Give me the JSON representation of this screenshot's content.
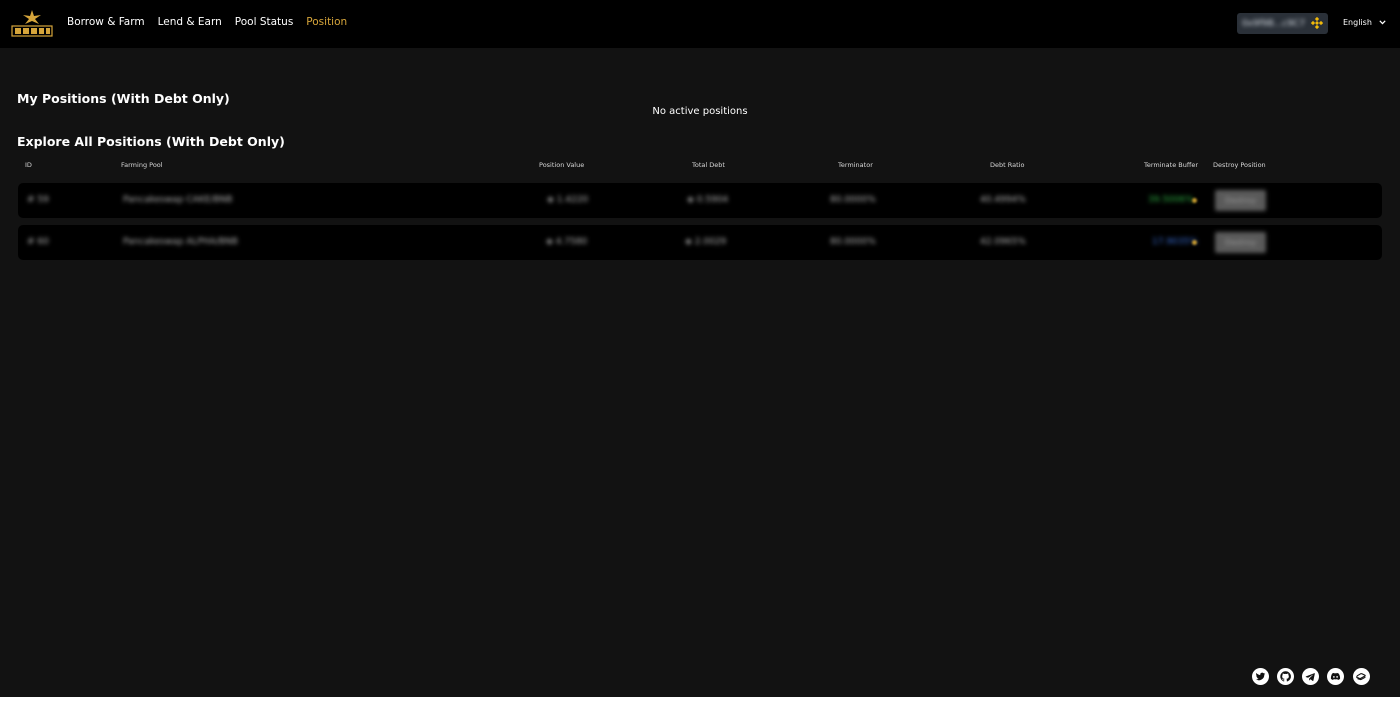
{
  "nav": {
    "items": [
      {
        "label": "Borrow & Farm",
        "active": false
      },
      {
        "label": "Lend & Earn",
        "active": false
      },
      {
        "label": "Pool Status",
        "active": false
      },
      {
        "label": "Position",
        "active": true
      }
    ]
  },
  "header": {
    "wallet_address": "0x9f9B...c9C7",
    "language": "English"
  },
  "my_positions": {
    "title": "My Positions (With Debt Only)",
    "empty_message": "No active positions"
  },
  "all_positions": {
    "title": "Explore All Positions (With Debt Only)",
    "columns": [
      "ID",
      "Farming Pool",
      "Position Value",
      "Total Debt",
      "Terminator",
      "Debt Ratio",
      "Terminate Buffer",
      "Destroy Position"
    ],
    "rows": [
      {
        "id": "# 59",
        "farming_pool": "Pancakeswap CAKE/BNB",
        "position_value": "◈ 1.4220",
        "total_debt": "◈ 0.5904",
        "terminator": "80.0000%",
        "debt_ratio": "40.4994%",
        "terminate_buffer": "39.5006%",
        "buffer_status": "good",
        "destroy_label": "Destroy"
      },
      {
        "id": "# 60",
        "farming_pool": "Pancakeswap ALPHA/BNB",
        "position_value": "◈ 4.7580",
        "total_debt": "◈ 2.0029",
        "terminator": "80.0000%",
        "debt_ratio": "42.0965%",
        "terminate_buffer": "17.9035%",
        "buffer_status": "info",
        "destroy_label": "Destroy"
      }
    ]
  },
  "colors": {
    "accent": "#d6a53b",
    "background": "#121212",
    "topbar": "#000000",
    "buffer_good": "#2fb344",
    "buffer_info": "#3a6fd8"
  },
  "footer": {
    "icons": [
      "twitter-icon",
      "github-icon",
      "telegram-icon",
      "discord-icon",
      "gitbook-icon"
    ]
  }
}
